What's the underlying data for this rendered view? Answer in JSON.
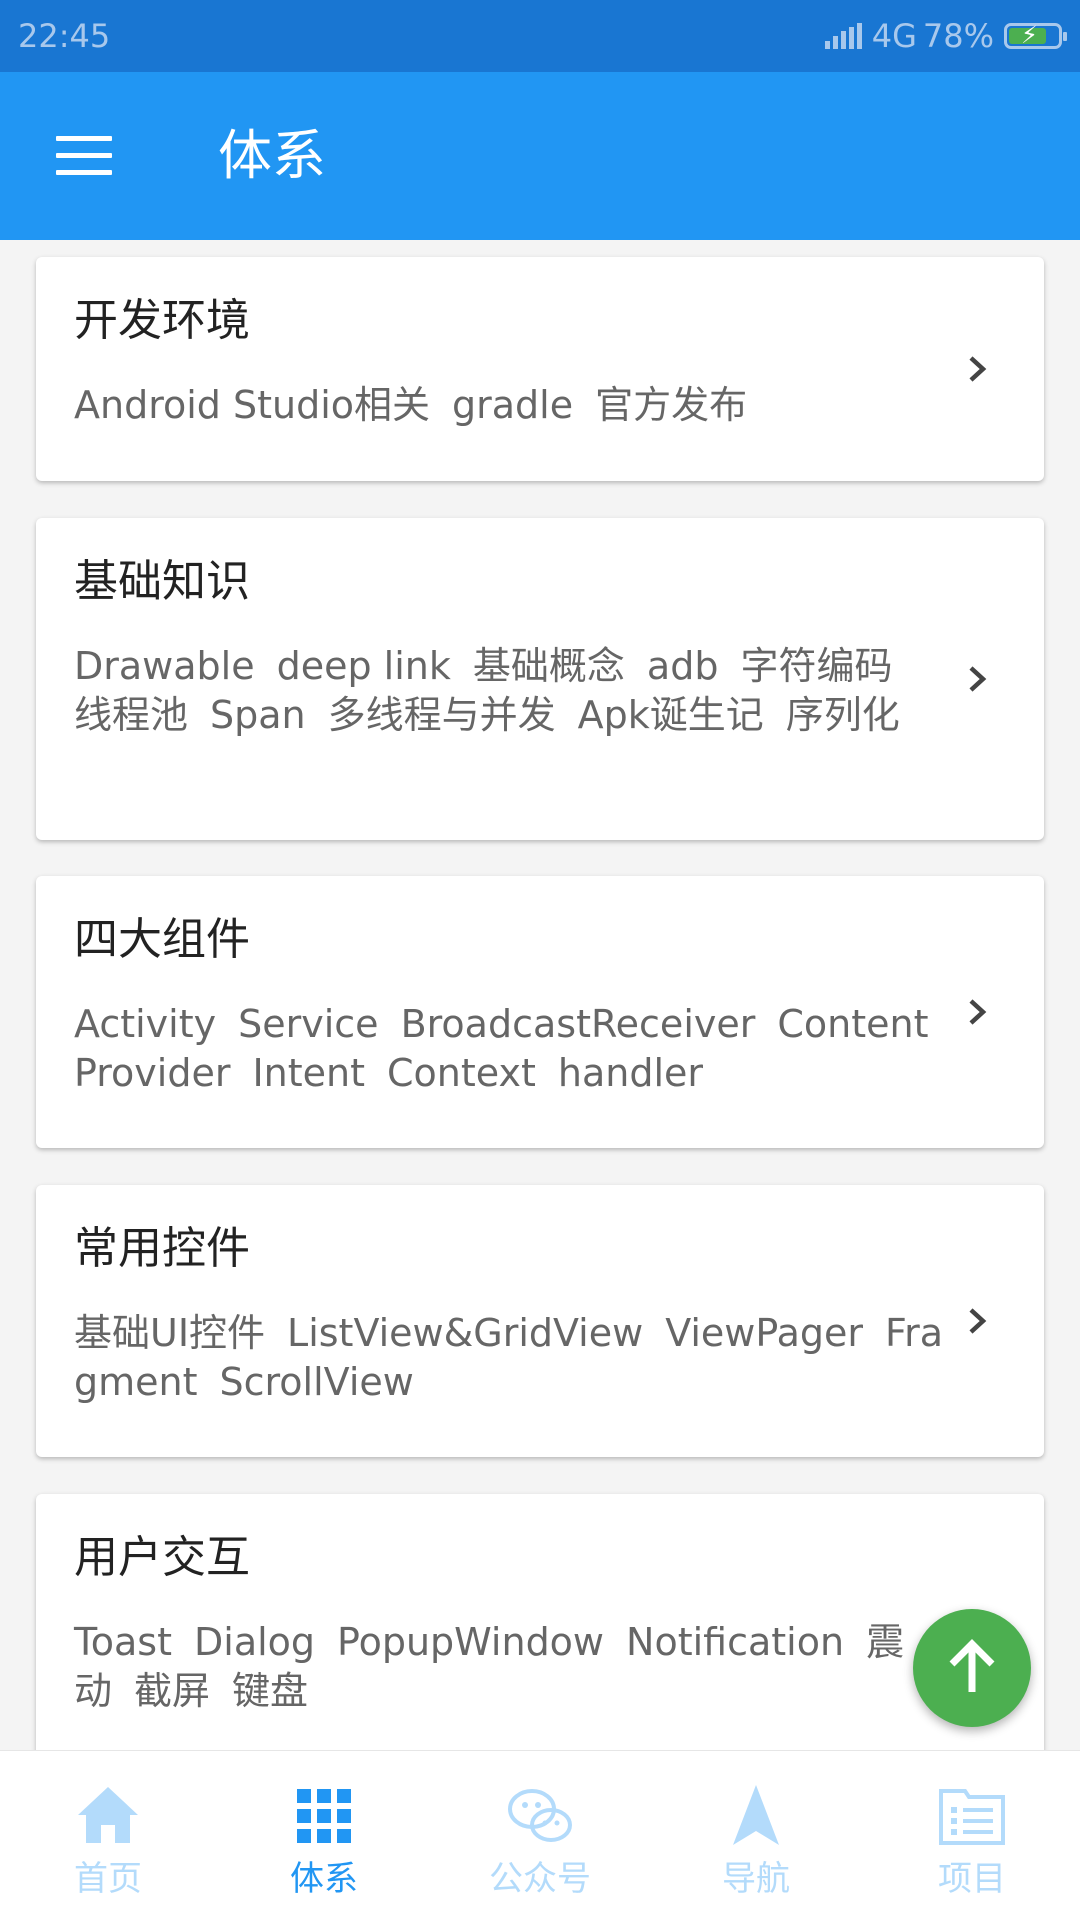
{
  "status_bar": {
    "time": "22:45",
    "network": "4G",
    "battery": "78%",
    "battery_level": 0.78
  },
  "toolbar": {
    "title": "体系"
  },
  "categories": [
    {
      "title": "开发环境",
      "tags": [
        "Android Studio相关",
        "gradle",
        "官方发布"
      ]
    },
    {
      "title": "基础知识",
      "tags": [
        "Drawable",
        "deep link",
        "基础概念",
        "adb",
        "字符编码",
        "线程池",
        "Span",
        "多线程与并发",
        "Apk诞生记",
        "序列化"
      ]
    },
    {
      "title": "四大组件",
      "tags": [
        "Activity",
        "Service",
        "BroadcastReceiver",
        "ContentProvider",
        "Intent",
        "Context",
        "handler"
      ]
    },
    {
      "title": "常用控件",
      "tags": [
        "基础UI控件",
        "ListView&GridView",
        "ViewPager",
        "Fragment",
        "ScrollView"
      ]
    },
    {
      "title": "用户交互",
      "tags": [
        "Toast",
        "Dialog",
        "PopupWindow",
        "Notification",
        "震动",
        "截屏",
        "键盘"
      ]
    }
  ],
  "bottom_nav": {
    "active_index": 1,
    "items": [
      {
        "label": "首页",
        "icon": "home-icon"
      },
      {
        "label": "体系",
        "icon": "grid-icon"
      },
      {
        "label": "公众号",
        "icon": "wechat-icon"
      },
      {
        "label": "导航",
        "icon": "navigation-icon"
      },
      {
        "label": "项目",
        "icon": "project-list-icon"
      }
    ]
  },
  "colors": {
    "primary": "#2196f3",
    "status_bar": "#1976d2",
    "fab": "#4caf50",
    "inactive_tab": "#b3dbfb"
  }
}
